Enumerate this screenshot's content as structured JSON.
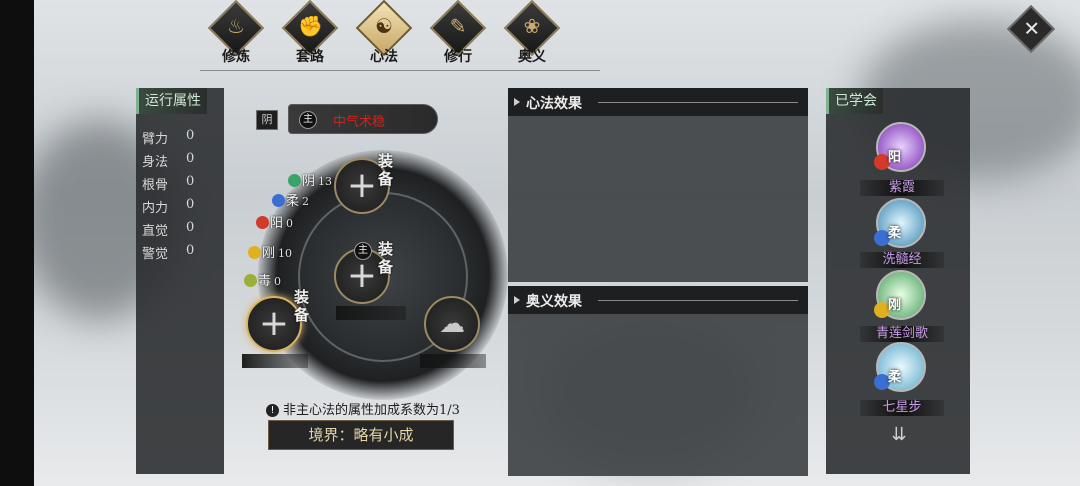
{
  "tabs": [
    {
      "label": "修炼",
      "icon": "flame-emblem-icon",
      "active": false
    },
    {
      "label": "套路",
      "icon": "fist-emblem-icon",
      "active": false
    },
    {
      "label": "心法",
      "icon": "yin-yang-emblem-icon",
      "active": true
    },
    {
      "label": "修行",
      "icon": "scroll-emblem-icon",
      "active": false
    },
    {
      "label": "奥义",
      "icon": "lotus-emblem-icon",
      "active": false
    }
  ],
  "close_icon": "close-x-icon",
  "attributes": {
    "title": "运行属性",
    "rows": [
      {
        "name": "臂力",
        "value": "0"
      },
      {
        "name": "身法",
        "value": "0"
      },
      {
        "name": "根骨",
        "value": "0"
      },
      {
        "name": "内力",
        "value": "0"
      },
      {
        "name": "直觉",
        "value": "0"
      },
      {
        "name": "警觉",
        "value": "0"
      }
    ]
  },
  "main_method": {
    "yin_label": "阴",
    "main_marker": "主",
    "name": "中气术稳"
  },
  "elements": [
    {
      "label": "阴",
      "value": "13",
      "color": "#3aa36a"
    },
    {
      "label": "柔",
      "value": "2",
      "color": "#3a6fd1"
    },
    {
      "label": "阳",
      "value": "0",
      "color": "#d23a2a"
    },
    {
      "label": "刚",
      "value": "10",
      "color": "#e0b020"
    },
    {
      "label": "毒",
      "value": "0",
      "color": "#9bb03a"
    }
  ],
  "slots": {
    "top": {
      "label": "装备",
      "icon": "plus-icon"
    },
    "center": {
      "label": "装备",
      "icon": "plus-icon",
      "marker": "主"
    },
    "left": {
      "label": "装备",
      "icon": "plus-icon"
    },
    "right": {
      "icon": "cloud-swirl-icon"
    }
  },
  "note": "非主心法的属性加成系数为1/3",
  "realm": "境界：略有小成",
  "effects": {
    "method_title": "心法效果",
    "ultimate_title": "奥义效果"
  },
  "learned": {
    "title": "已学会",
    "skills": [
      {
        "name": "紫霞",
        "element": "阳",
        "icon": "purple-mist-icon"
      },
      {
        "name": "洗髓经",
        "element": "柔",
        "icon": "blue-wave-icon"
      },
      {
        "name": "青莲剑歌",
        "element": "刚",
        "icon": "green-lotus-icon"
      },
      {
        "name": "七星步",
        "element": "柔",
        "icon": "star-step-icon"
      }
    ],
    "more_icon": "scroll-down-arrow-icon"
  },
  "colors": {
    "accent_gold": "#d8b46a",
    "panel_dark": "#2a2c2e",
    "learned_name": "#c89ce8"
  }
}
